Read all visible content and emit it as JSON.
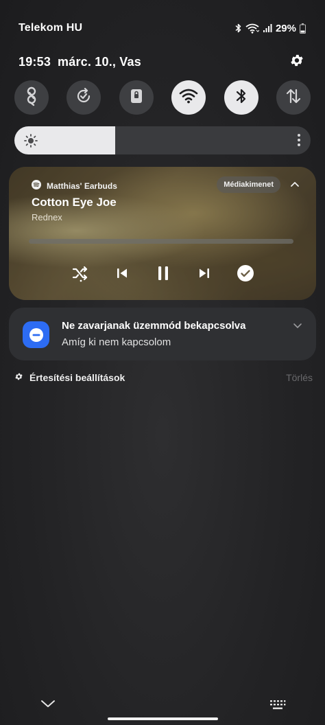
{
  "status_bar": {
    "carrier": "Telekom HU",
    "battery": "29%",
    "icons": [
      "bluetooth-icon",
      "wifi-icon",
      "signal-icon",
      "battery-icon"
    ]
  },
  "header": {
    "time": "19:53",
    "date": "márc. 10., Vas",
    "settings_icon": "gear-icon"
  },
  "quick_toggles": [
    {
      "name": "nfc",
      "icon": "nfc-icon",
      "on": false
    },
    {
      "name": "auto-rotate",
      "icon": "rotate-icon",
      "on": false
    },
    {
      "name": "lock-screen",
      "icon": "lock-icon",
      "on": false
    },
    {
      "name": "wifi",
      "icon": "wifi-icon",
      "on": true
    },
    {
      "name": "bluetooth",
      "icon": "bluetooth-icon",
      "on": true
    },
    {
      "name": "mobile-data",
      "icon": "data-transfer-icon",
      "on": false
    }
  ],
  "brightness": {
    "level": 0.34
  },
  "media": {
    "app_icon": "spotify-icon",
    "source": "Matthias' Earbuds",
    "output_button": "Médiakimenet",
    "title": "Cotton Eye Joe",
    "artist": "Rednex",
    "progress": 0.0,
    "controls": [
      "shuffle-icon",
      "previous-icon",
      "pause-icon",
      "next-icon",
      "check-circle-icon"
    ]
  },
  "dnd_notification": {
    "title": "Ne zavarjanak üzemmód bekapcsolva",
    "subtitle": "Amíg ki nem kapcsolom",
    "icon": "minus-circle-icon"
  },
  "footer": {
    "settings_label": "Értesítési beállítások",
    "clear_label": "Törlés"
  },
  "colors": {
    "toggle_on": "#e9e9eb",
    "toggle_off": "#3e3f42",
    "dnd_accent": "#2d6cf3",
    "background": "#232325"
  }
}
